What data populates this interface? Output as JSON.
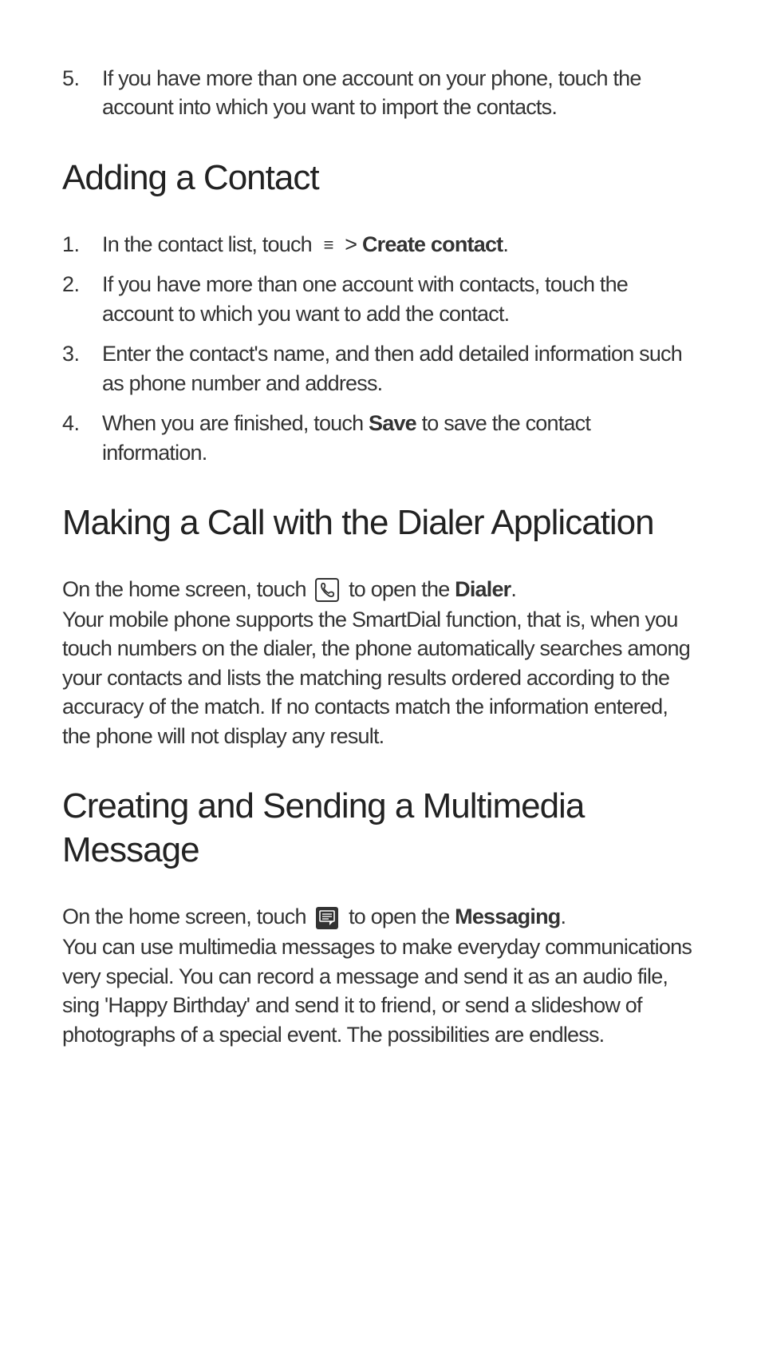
{
  "preList": {
    "num": "5.",
    "text": "If you have more than one account on your phone, touch the account into which you want to import the contacts."
  },
  "section1": {
    "heading": "Adding a Contact",
    "items": [
      {
        "num": "1.",
        "prefix": "In the contact list, touch ",
        "greaterThan": " > ",
        "bold": "Create contact",
        "suffix": "."
      },
      {
        "num": "2.",
        "text": "If you have more than one account with contacts, touch the account to which you want to add the contact."
      },
      {
        "num": "3.",
        "text": "Enter the contact's name, and then add detailed information such as phone number and address."
      },
      {
        "num": "4.",
        "prefix": "When you are finished, touch ",
        "bold": "Save",
        "suffix": " to save the contact information."
      }
    ]
  },
  "section2": {
    "heading": "Making a Call with the Dialer Application",
    "para": {
      "prefix": "On the home screen, touch ",
      "mid": " to open the ",
      "bold": "Dialer",
      "period": ".",
      "rest": "Your mobile phone supports the SmartDial function, that is, when you touch numbers on the dialer, the phone automatically searches among your contacts and lists the matching results ordered according to the accuracy of the match. If no contacts match the information entered, the phone will not display any result."
    }
  },
  "section3": {
    "heading": "Creating and Sending a Multimedia Message",
    "para": {
      "prefix": "On the home screen, touch ",
      "mid": " to open the ",
      "bold": "Messaging",
      "period": ".",
      "rest": "You can use multimedia messages to make everyday communications very special. You can record a message and send it as an audio file, sing 'Happy Birthday' and send it to friend, or send a slideshow of photographs of a special event. The possibilities are endless."
    }
  }
}
